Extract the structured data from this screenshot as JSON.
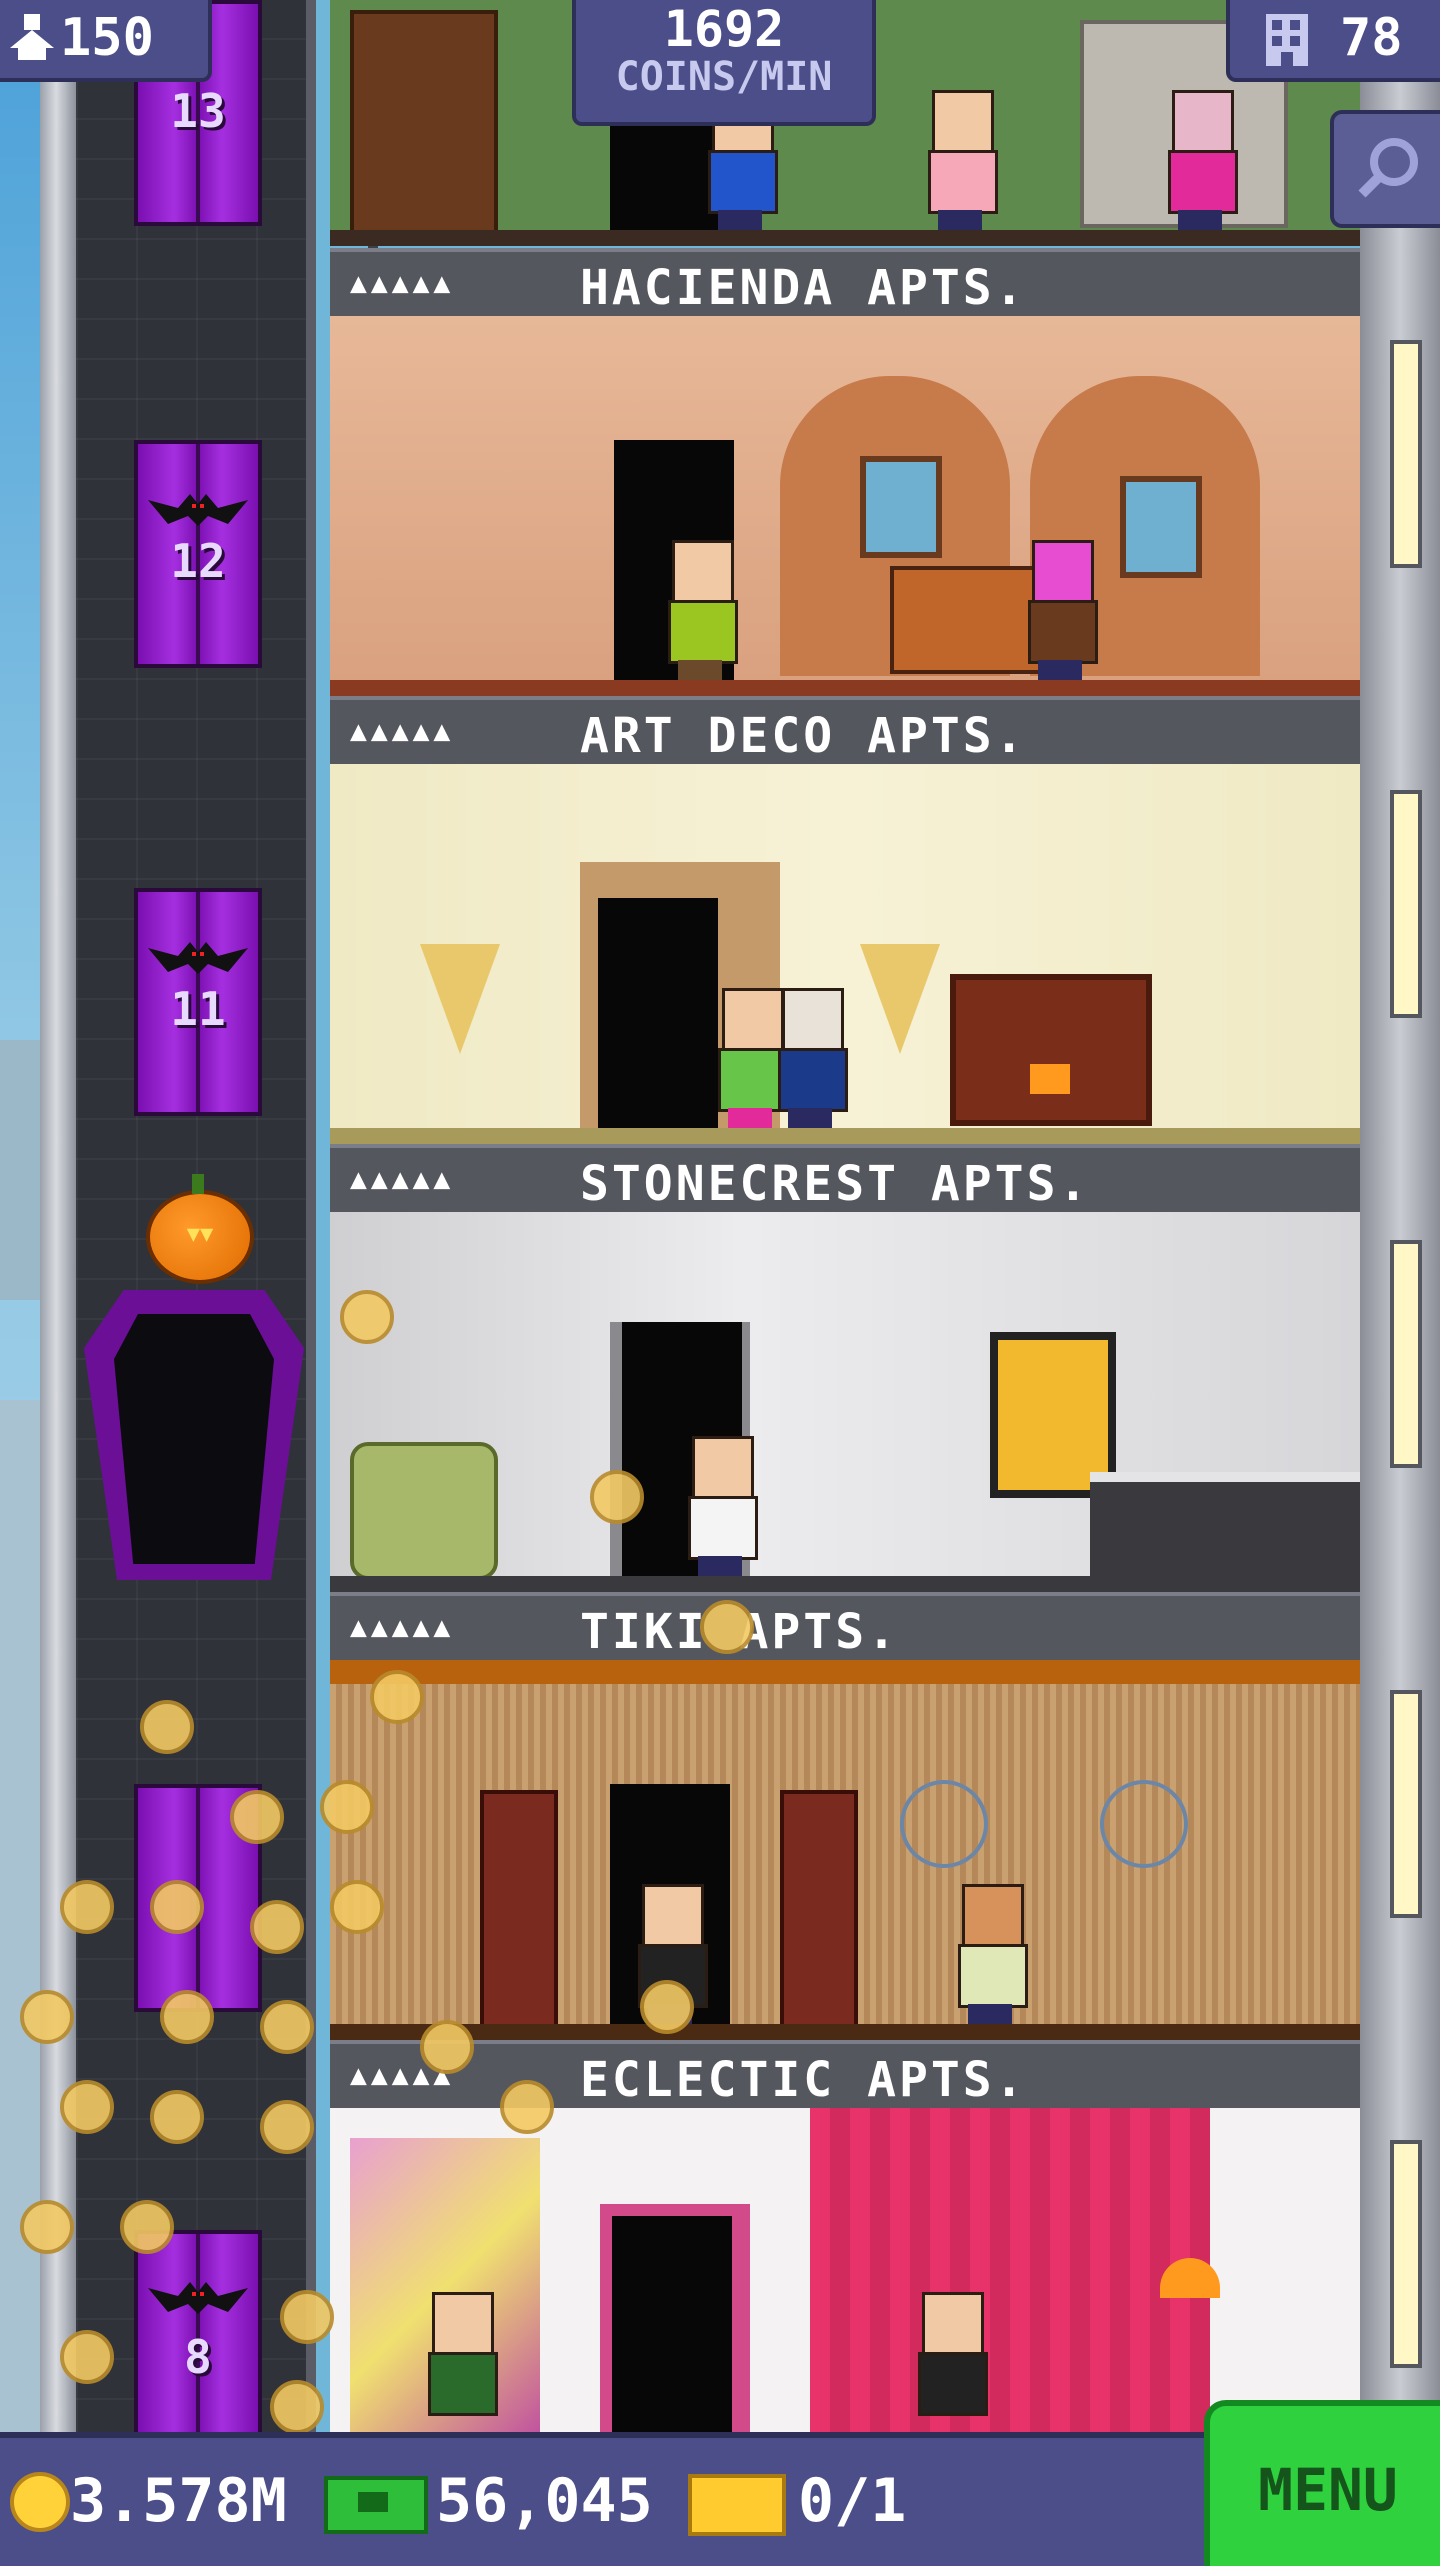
{
  "hud": {
    "population": "150",
    "coins_per_min_value": "1692",
    "coins_per_min_label": "COINS/MIN",
    "floor_count": "78"
  },
  "elevator": {
    "floor_labels": [
      "13",
      "12",
      "11",
      "8"
    ]
  },
  "floors": [
    {
      "name": "HACIENDA APTS.",
      "rating": "▲▲▲▲▲"
    },
    {
      "name": "ART DECO APTS.",
      "rating": "▲▲▲▲▲"
    },
    {
      "name": "STONECREST APTS.",
      "rating": "▲▲▲▲▲"
    },
    {
      "name": "TIKI APTS.",
      "rating": "▲▲▲▲▲"
    },
    {
      "name": "ECLECTIC APTS.",
      "rating": "▲▲▲▲▲"
    }
  ],
  "bottom": {
    "coins": "3.578M",
    "bux": "56,045",
    "tickets": "0/1",
    "menu_label": "MENU"
  },
  "icons": {
    "population": "person-up-icon",
    "floors": "building-icon",
    "search": "magnifier-icon",
    "coins": "coin-icon",
    "bux": "tower-bux-icon",
    "tickets": "ticket-icon"
  },
  "colors": {
    "hud_bg": "#4b4e88",
    "elevator_door": "#8a1fc4",
    "menu_green": "#2fd23e"
  }
}
